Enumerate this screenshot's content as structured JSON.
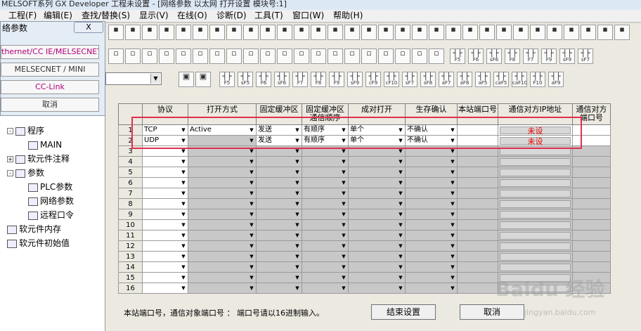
{
  "window": {
    "title": "MELSOFT系列 GX Developer 工程未设置 - [网络参数 以太网 打开设置 模块号:1]"
  },
  "menu": [
    "工程(F)",
    "编辑(E)",
    "查找/替换(S)",
    "显示(V)",
    "在线(O)",
    "诊断(D)",
    "工具(T)",
    "窗口(W)",
    "帮助(H)"
  ],
  "toolbar": {
    "row2_fkeys": [
      "F5",
      "F6",
      "sF6",
      "F8",
      "F7",
      "F9",
      "sF9",
      "sF7"
    ],
    "row3_fkeys": [
      "F5",
      "sF5",
      "F6",
      "sF6",
      "F7",
      "F8",
      "F9",
      "sF9",
      "cF9",
      "cF10",
      "sF7",
      "sF8",
      "aF7",
      "aF8",
      "aF5",
      "caF5",
      "caF10",
      "F10",
      "aF9"
    ]
  },
  "dialog": {
    "title": "络参数",
    "close": "X",
    "buttons": [
      "thernet/CC IE/MELSECNET",
      "MELSECNET / MINI",
      "CC-Link",
      "取消"
    ]
  },
  "tree": [
    {
      "label": "程序",
      "level": 1,
      "expander": "-"
    },
    {
      "label": "MAIN",
      "level": 2
    },
    {
      "label": "软元件注释",
      "level": 1,
      "expander": "+"
    },
    {
      "label": "参数",
      "level": 1,
      "expander": "-"
    },
    {
      "label": "PLC参数",
      "level": 2
    },
    {
      "label": "网络参数",
      "level": 2
    },
    {
      "label": "远程口令",
      "level": 2
    },
    {
      "label": "软元件内存",
      "level": 1
    },
    {
      "label": "软元件初始值",
      "level": 1
    }
  ],
  "grid": {
    "headers": [
      "协议",
      "打开方式",
      "固定缓冲区",
      "固定缓冲区通信顺序",
      "成对打开",
      "生存确认",
      "本站端口号",
      "通信对方IP地址",
      "通信对方端口号"
    ],
    "rows": [
      {
        "num": "1",
        "protocol": "TCP",
        "open": "Active",
        "fixed_buf": "发送",
        "order": "有顺序",
        "pair": "单个",
        "alive": "不确认",
        "local_port": "",
        "ip": "未设",
        "remote_port": ""
      },
      {
        "num": "2",
        "protocol": "UDP",
        "open": "",
        "fixed_buf": "发送",
        "order": "有顺序",
        "pair": "单个",
        "alive": "不确认",
        "local_port": "",
        "ip": "未设",
        "remote_port": ""
      },
      {
        "num": "3"
      },
      {
        "num": "4"
      },
      {
        "num": "5"
      },
      {
        "num": "6"
      },
      {
        "num": "7"
      },
      {
        "num": "8"
      },
      {
        "num": "9"
      },
      {
        "num": "10"
      },
      {
        "num": "11"
      },
      {
        "num": "12"
      },
      {
        "num": "13"
      },
      {
        "num": "14"
      },
      {
        "num": "15"
      },
      {
        "num": "16"
      }
    ]
  },
  "footer": {
    "note": "本站端口号，通信对象端口号 ： 端口号请以16进制输入。",
    "end_button": "结束设置",
    "cancel_button": "取消"
  },
  "watermark": {
    "main": "Baidu 经验",
    "sub": "jingyan.baidu.com"
  }
}
